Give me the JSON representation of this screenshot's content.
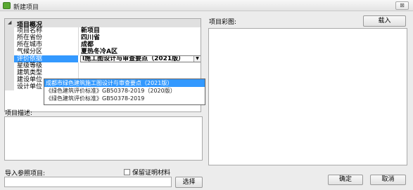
{
  "window": {
    "title": "新建项目",
    "close_label": "⊠"
  },
  "grid": {
    "category": "项目概况",
    "rows": [
      {
        "name": "项目名称",
        "value": "新项目"
      },
      {
        "name": "所在省份",
        "value": "四川省"
      },
      {
        "name": "所在城市",
        "value": "成都"
      },
      {
        "name": "气候分区",
        "value": "夏热冬冷A区"
      },
      {
        "name": "评价依据",
        "value": "l施工图设计与审查要点（2021版）"
      },
      {
        "name": "星级等级",
        "value": ""
      },
      {
        "name": "建筑类型",
        "value": ""
      },
      {
        "name": "建设单位",
        "value": ""
      },
      {
        "name": "设计单位",
        "value": ""
      }
    ]
  },
  "dropdown": {
    "options": [
      "成都市绿色建筑施工图设计与审查要点（2021版）",
      "《绿色建筑评价标准》GB50378-2019（2020版）",
      "《绿色建筑评价标准》GB50378-2019"
    ],
    "selected_index": 0
  },
  "description": {
    "label": "项目描述:"
  },
  "image": {
    "label": "项目彩图:",
    "load_button": "载入"
  },
  "import": {
    "label": "导入参照项目:",
    "keep_label": "保留证明材料",
    "select_button": "选择"
  },
  "buttons": {
    "ok": "确定",
    "cancel": "取消"
  }
}
